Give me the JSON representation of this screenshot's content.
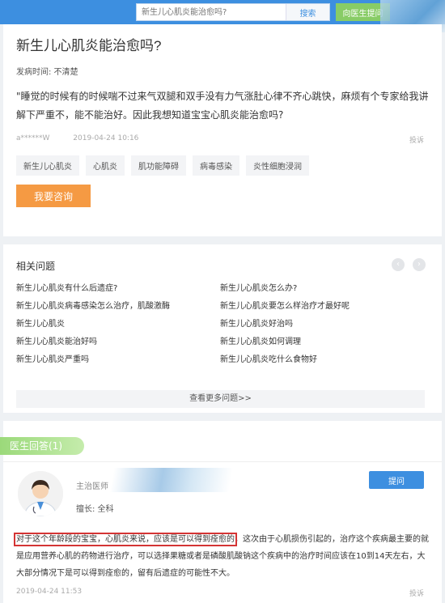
{
  "topbar": {
    "search_placeholder": "新生儿心肌炎能治愈吗?",
    "search_button": "搜索",
    "ask_doctor_button": "向医生提问"
  },
  "question": {
    "title": "新生儿心肌炎能治愈吗?",
    "onset": "发病时间:  不清楚",
    "body": "\"睡觉的时候有的时候喘不过来气双腿和双手没有力气涨肚心律不齐心跳快，麻烦有个专家给我讲解下严重不，能不能治好。因此我想知道宝宝心肌炎能治愈吗?",
    "user": "a******W",
    "time": "2019-04-24 10:16",
    "report": "投诉",
    "tags": [
      "新生儿心肌炎",
      "心肌炎",
      "肌功能障碍",
      "病毒感染",
      "炎性细胞浸润"
    ],
    "consult_button": "我要咨询"
  },
  "related": {
    "heading": "相关问题",
    "left": [
      "新生儿心肌炎有什么后遗症?",
      "新生儿心肌炎病毒感染怎么治疗，肌酸激酶",
      "新生儿心肌炎",
      "新生儿心肌炎能治好吗",
      "新生儿心肌炎严重吗"
    ],
    "right": [
      "新生儿心肌炎怎么办?",
      "新生儿心肌炎要怎么样治疗才最好呢",
      "新生儿心肌炎好治吗",
      "新生儿心肌炎如何调理",
      "新生儿心肌炎吃什么食物好"
    ],
    "more": "查看更多问题>>",
    "prev": "‹",
    "next": "›"
  },
  "answers": {
    "tab": "医生回答(1)",
    "doctor_title": "主治医师",
    "specialty": "擅长:  全科",
    "follow_button": "提问",
    "answer_highlight": "对于这个年龄段的宝宝，心肌炎来说，应该是可以得到痊愈的",
    "answer_rest": "，这次由于心肌损伤引起的，治疗这个疾病最主要的就是应用营养心肌的药物进行治疗，可以选择果糖或者是磷酸肌酸钠这个疾病中的治疗时间应该在10到14天左右，大大部分情况下是可以得到痊愈的，留有后遗症的可能性不大。",
    "time": "2019-04-24 11:53",
    "report": "投诉"
  },
  "colors": {
    "primary": "#3d8fe0",
    "orange": "#f59a43",
    "green": "#88cc66",
    "highlight": "#d43434"
  }
}
